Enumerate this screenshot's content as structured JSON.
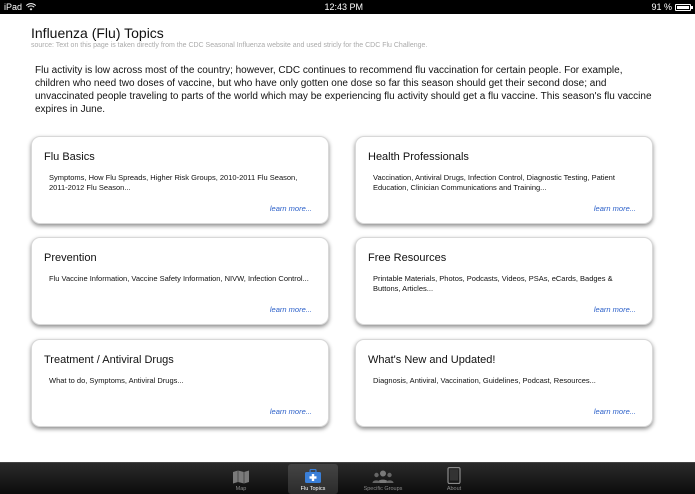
{
  "statusbar": {
    "device": "iPad",
    "time": "12:43 PM",
    "battery": "91 %"
  },
  "page": {
    "title": "Influenza (Flu) Topics",
    "source": "source: Text on this page is taken directly from the CDC Seasonal Influenza website and used stricly for the CDC Flu Challenge.",
    "intro": "Flu activity is low across most of the country; however, CDC continues to recommend flu vaccination for certain people. For example, children who need two doses of vaccine, but who have only gotten one dose so far this season should get their second dose; and unvaccinated people traveling to parts of the world which may be experiencing flu activity should get a flu vaccine. This season's flu vaccine expires in June."
  },
  "cards": [
    {
      "title": "Flu Basics",
      "desc": "Symptoms, How Flu Spreads, Higher Risk Groups, 2010-2011 Flu Season, 2011-2012 Flu Season...",
      "more": "learn more..."
    },
    {
      "title": "Health Professionals",
      "desc": "Vaccination, Antiviral Drugs, Infection Control, Diagnostic Testing, Patient Education, Clinician Communications and Training...",
      "more": "learn more..."
    },
    {
      "title": "Prevention",
      "desc": "Flu Vaccine Information, Vaccine Safety Information, NIVW, Infection Control...",
      "more": "learn more..."
    },
    {
      "title": "Free Resources",
      "desc": "Printable Materials, Photos, Podcasts, Videos, PSAs, eCards, Badges & Buttons, Articles...",
      "more": "learn more..."
    },
    {
      "title": "Treatment / Antiviral Drugs",
      "desc": "What to do, Symptoms, Antiviral Drugs...",
      "more": "learn more..."
    },
    {
      "title": "What's New and Updated!",
      "desc": "Diagnosis, Antiviral, Vaccination, Guidelines, Podcast, Resources...",
      "more": "learn more..."
    }
  ],
  "tabs": [
    {
      "label": "Map",
      "icon": "map-icon"
    },
    {
      "label": "Flu Topics",
      "icon": "medical-kit-icon",
      "selected": true
    },
    {
      "label": "Specific Groups",
      "icon": "people-group-icon"
    },
    {
      "label": "About",
      "icon": "device-icon"
    }
  ],
  "colors": {
    "link": "#2a5fc9",
    "tabbar": "#1a1a1a",
    "accent_icon": "#3a7fd8"
  }
}
